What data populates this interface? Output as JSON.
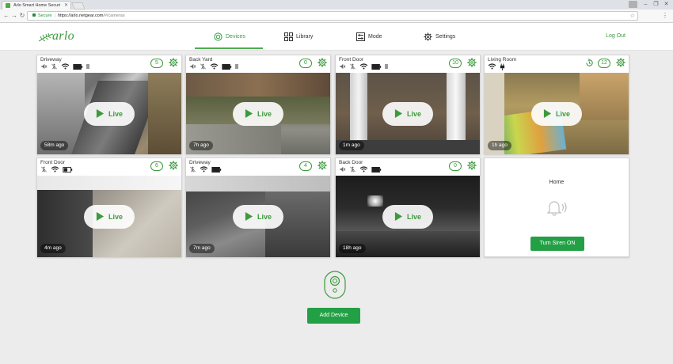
{
  "browser": {
    "tab_title": "Arlo Smart Home Securi",
    "secure_label": "Secure",
    "url_main": "https://arlo.netgear.com",
    "url_path": "/#/cameras"
  },
  "header": {
    "logo_text": "arlo",
    "nav": [
      {
        "label": "Devices",
        "icon": "devices-icon",
        "active": true
      },
      {
        "label": "Library",
        "icon": "library-icon",
        "active": false
      },
      {
        "label": "Mode",
        "icon": "mode-icon",
        "active": false
      },
      {
        "label": "Settings",
        "icon": "gear-icon",
        "active": false
      }
    ],
    "logout_label": "Log Out"
  },
  "cameras": [
    {
      "name": "Driveway",
      "count": "5",
      "ago": "58m ago",
      "live_label": "Live"
    },
    {
      "name": "Back Yard",
      "count": "0",
      "ago": "7h ago",
      "live_label": "Live"
    },
    {
      "name": "Front Door",
      "count": "10",
      "ago": "1m ago",
      "live_label": "Live"
    },
    {
      "name": "Living Room",
      "count": "12",
      "ago": "1h ago",
      "live_label": "Live"
    },
    {
      "name": "Front Door",
      "count": "6",
      "ago": "4m ago",
      "live_label": "Live"
    },
    {
      "name": "Driveway",
      "count": "4",
      "ago": "7m ago",
      "live_label": "Live"
    },
    {
      "name": "Back Door",
      "count": "0",
      "ago": "18h ago",
      "live_label": "Live"
    }
  ],
  "mode_card": {
    "title": "Home",
    "siren_label": "Turn Siren ON"
  },
  "add_device_label": "Add Device",
  "colors": {
    "accent": "#3c9a3c",
    "button": "#23a045",
    "background": "#ececec"
  }
}
